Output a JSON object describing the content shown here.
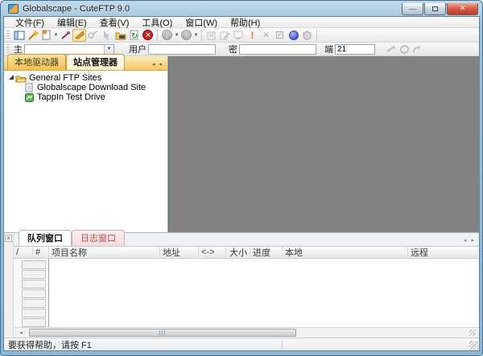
{
  "window": {
    "title": "Globalscape - CuteFTP 9.0",
    "controls": {
      "minimize": "minimize",
      "maximize": "maximize",
      "close": "close"
    }
  },
  "menu": {
    "items": [
      "文件(F)",
      "编辑(E)",
      "查看(V)",
      "工具(O)",
      "窗口(W)",
      "帮助(H)"
    ]
  },
  "toolbar": {
    "icons": [
      {
        "name": "site-manager-icon",
        "enabled": true
      },
      {
        "name": "connection-wizard-icon",
        "enabled": true
      },
      {
        "name": "new-site-icon",
        "enabled": true,
        "dropdown": true
      },
      {
        "name": "connect-icon",
        "enabled": true
      },
      {
        "name": "display-site-manager-icon",
        "enabled": true,
        "pressed": true
      },
      {
        "name": "disconnect-icon",
        "enabled": false
      },
      {
        "name": "pointer-icon",
        "enabled": false
      },
      {
        "name": "site-properties-icon",
        "enabled": true
      },
      {
        "name": "refresh-icon",
        "enabled": true
      },
      {
        "name": "stop-icon",
        "enabled": true
      },
      {
        "name": "download-icon",
        "enabled": false,
        "dropdown": true
      },
      {
        "name": "upload-icon",
        "enabled": false,
        "dropdown": true
      },
      {
        "name": "transfer-queue-icon",
        "enabled": false
      },
      {
        "name": "edit-file-icon",
        "enabled": false
      },
      {
        "name": "view-file-icon",
        "enabled": false
      },
      {
        "name": "priority-icon",
        "enabled": true
      },
      {
        "name": "delete-icon",
        "enabled": false
      },
      {
        "name": "checkbox-icon",
        "enabled": false
      },
      {
        "name": "globalscape-icon",
        "enabled": true
      },
      {
        "name": "tappin-shield-icon",
        "enabled": false
      }
    ],
    "dropdown_glyph": "▼"
  },
  "quick_connect": {
    "host_label": "主",
    "host_value": "",
    "user_label": "用户",
    "user_value": "",
    "password_label": "密",
    "password_value": "",
    "port_label": "端",
    "port_value": "21",
    "buttons": [
      "quick-connect-plug-icon",
      "abort-icon",
      "reconnect-icon"
    ]
  },
  "left_panel": {
    "tabs": [
      {
        "label": "本地驱动器",
        "active": false
      },
      {
        "label": "站点管理器",
        "active": true
      }
    ],
    "tab_scroll_arrows": "◂ ▸",
    "tree": [
      {
        "label": "General FTP Sites",
        "icon": "folder-open-icon",
        "expanded": true,
        "level": 0
      },
      {
        "label": "Globalscape Download Site",
        "icon": "site-document-icon",
        "level": 1
      },
      {
        "label": "TappIn Test Drive",
        "icon": "tappin-icon",
        "level": 1
      }
    ]
  },
  "bottom_panel": {
    "close_glyph": "×",
    "tabs": [
      {
        "label": "队列窗口",
        "active": true
      },
      {
        "label": "日志窗口",
        "active": false
      }
    ],
    "tab_scroll_arrows": "◂ ▸",
    "queue_columns": [
      "/",
      "#",
      "项目名称",
      "地址",
      "<->",
      "大小",
      "进度",
      "本地",
      "远程"
    ],
    "rows": []
  },
  "status_bar": {
    "help_text": "要获得帮助，请按 F1"
  },
  "colors": {
    "mdi_background": "#828282",
    "site_tabs_accent": "#f3c964",
    "log_tab_text": "#c05050",
    "close_button": "#c03a22",
    "stop_icon": "#cc2222",
    "refresh_icon": "#2e9e3a",
    "tappin_icon": "#52b848",
    "wand_icon": "#f0b429",
    "globalscape_sphere": "#5b6ee1"
  }
}
